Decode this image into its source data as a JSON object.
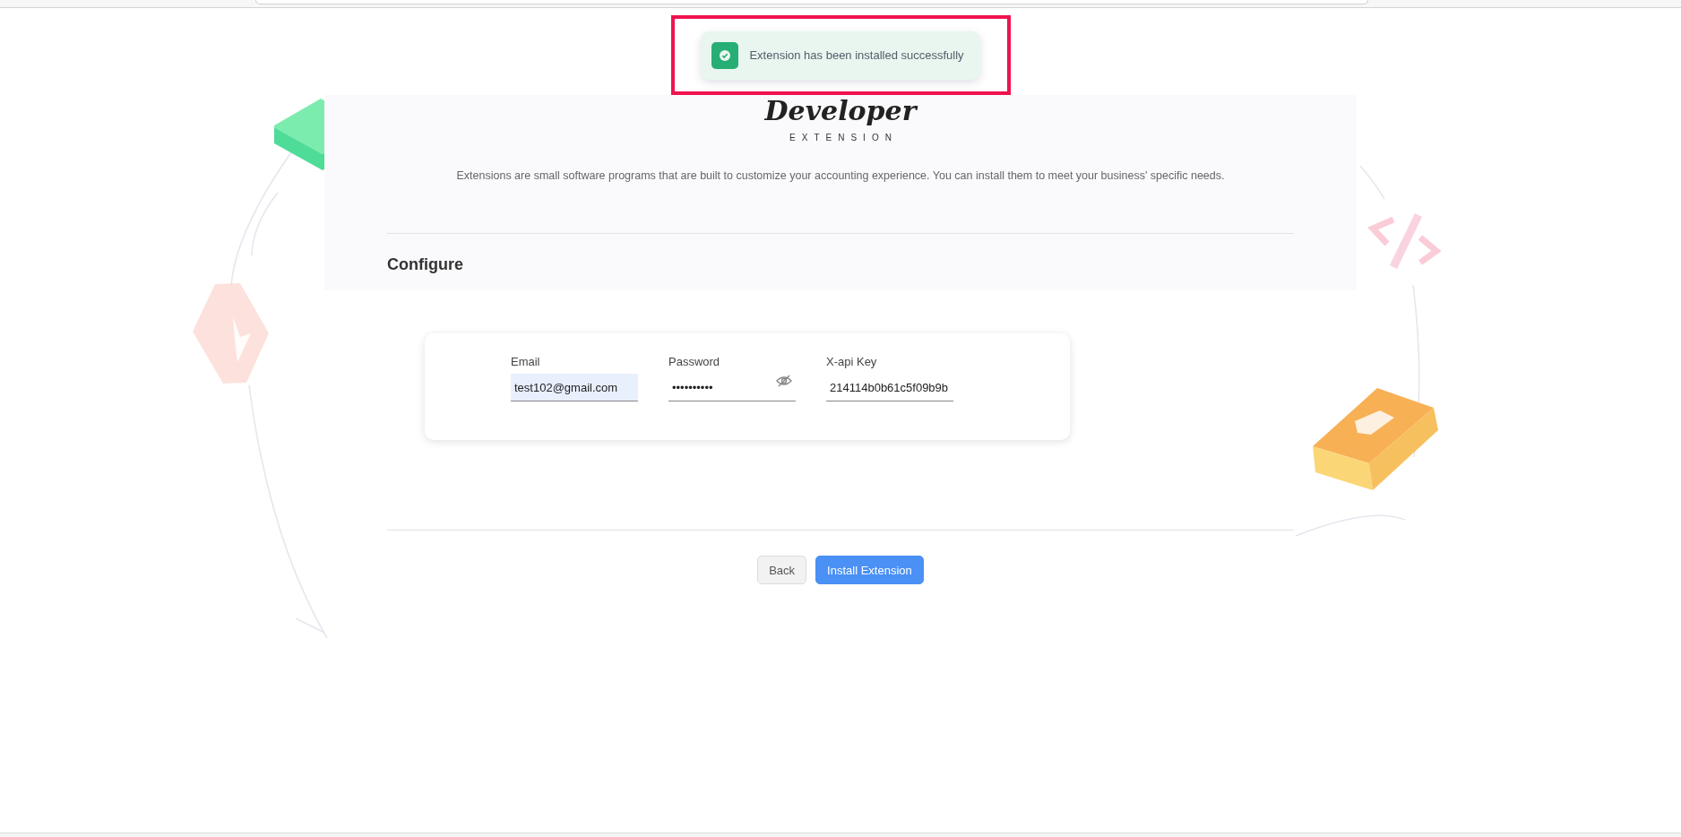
{
  "toast": {
    "message": "Extension has been installed successfully",
    "kind": "success",
    "highlighted": true
  },
  "brand": {
    "title": "Developer",
    "subtitle": "EXTENSION"
  },
  "description": "Extensions are small software programs that are built to customize your accounting experience. You can install them to meet your business' specific needs.",
  "section_title": "Configure",
  "fields": [
    {
      "label": "Email",
      "value": "test102@gmail.com",
      "kind": "text",
      "autofilled": true
    },
    {
      "label": "Password",
      "value": "••••••••••",
      "kind": "password",
      "autofilled": false,
      "revealed": false
    },
    {
      "label": "X-api Key",
      "value": "214114b0b61c5f09b9b",
      "kind": "text",
      "autofilled": false
    }
  ],
  "buttons": [
    {
      "label": "Back",
      "kind": "secondary"
    },
    {
      "label": "Install Extension",
      "kind": "primary"
    }
  ]
}
